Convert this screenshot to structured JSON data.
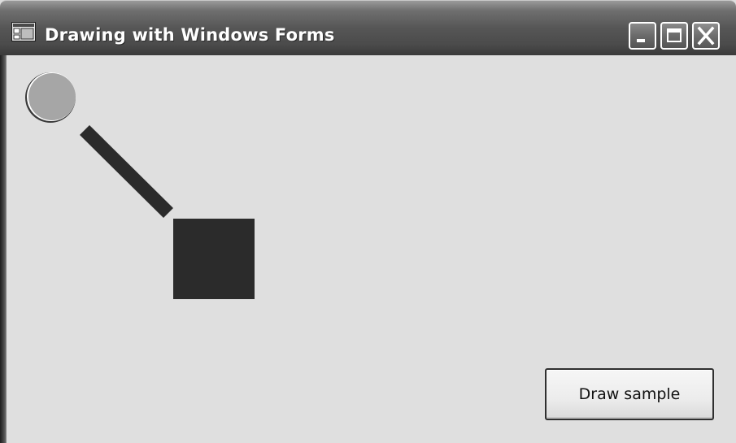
{
  "window": {
    "title": "Drawing with Windows Forms"
  },
  "caption_buttons": {
    "minimize_icon": "minimize-icon",
    "maximize_icon": "maximize-icon",
    "close_icon": "close-icon"
  },
  "canvas": {
    "shapes": [
      "circle",
      "line",
      "square"
    ]
  },
  "draw_button": {
    "label": "Draw sample"
  },
  "colors": {
    "client_background": "#dfdfdf",
    "circle_fill": "#a6a6a6",
    "shape_fill": "#2b2b2b"
  }
}
